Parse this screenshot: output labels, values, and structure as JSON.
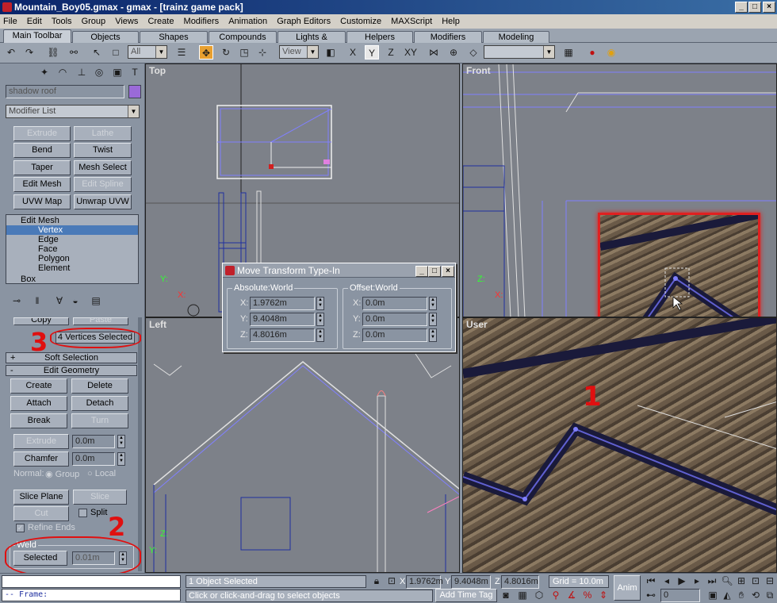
{
  "window": {
    "title": "Mountain_Boy05.gmax - gmax - [trainz game pack]",
    "min": "_",
    "max": "□",
    "close": "×"
  },
  "menu": [
    "File",
    "Edit",
    "Tools",
    "Group",
    "Views",
    "Create",
    "Modifiers",
    "Animation",
    "Graph Editors",
    "Customize",
    "MAXScript",
    "Help"
  ],
  "tabs": [
    "Main Toolbar",
    "Objects",
    "Shapes",
    "Compounds",
    "Lights & Cameras",
    "Helpers",
    "Modifiers",
    "Modeling"
  ],
  "toolbar": {
    "selection_filter": "All",
    "ref_coord": "View",
    "named_selection": ""
  },
  "command_panel": {
    "object_name": "shadow roof",
    "modifier_list": "Modifier List",
    "modifier_buttons": [
      "Extrude",
      "Lathe",
      "Bend",
      "Twist",
      "Taper",
      "Mesh Select",
      "Edit Mesh",
      "Edit Spline",
      "UVW Map",
      "Unwrap UVW"
    ],
    "stack": [
      "Edit Mesh",
      "Vertex",
      "Edge",
      "Face",
      "Polygon",
      "Element",
      "Box"
    ],
    "copy": "Copy",
    "paste": "Paste",
    "selection_status": "4 Vertices Selected",
    "soft_selection": "Soft Selection",
    "edit_geometry": "Edit Geometry",
    "geo_buttons": [
      "Create",
      "Delete",
      "Attach",
      "Detach",
      "Break",
      "Turn"
    ],
    "extrude": "Extrude",
    "extrude_val": "0.0m",
    "chamfer": "Chamfer",
    "chamfer_val": "0.0m",
    "normal": "Normal:",
    "group": "Group",
    "local": "Local",
    "slice_plane": "Slice Plane",
    "slice": "Slice",
    "cut": "Cut",
    "split": "Split",
    "refine_ends": "Refine Ends",
    "weld": "Weld",
    "weld_selected": "Selected",
    "weld_val": "0.01m"
  },
  "viewports": {
    "top": "Top",
    "front": "Front",
    "left": "Left",
    "user": "User"
  },
  "dialog": {
    "title": "Move Transform Type-In",
    "absolute": "Absolute:World",
    "offset": "Offset:World",
    "abs": {
      "x": "1.9762m",
      "y": "9.4048m",
      "z": "4.8016m"
    },
    "off": {
      "x": "0.0m",
      "y": "0.0m",
      "z": "0.0m"
    },
    "axis": {
      "x": "X:",
      "y": "Y:",
      "z": "Z:"
    }
  },
  "annotations": {
    "one": "1",
    "two": "2",
    "three": "3"
  },
  "status": {
    "frame": "-- Frame:",
    "selected": "1 Object Selected",
    "prompt": "Click or click-and-drag to select objects",
    "x": "1.9762m",
    "y": "9.4048m",
    "z": "4.8016m",
    "x_lbl": "X",
    "y_lbl": "Y",
    "z_lbl": "Z",
    "grid": "Grid = 10.0m",
    "add_time_tag": "Add Time Tag",
    "anim": "Anim",
    "frame_val": "0"
  },
  "colors": {
    "accent": "#e8a030",
    "annotation": "#e01010",
    "selection": "#5a7ac8"
  }
}
